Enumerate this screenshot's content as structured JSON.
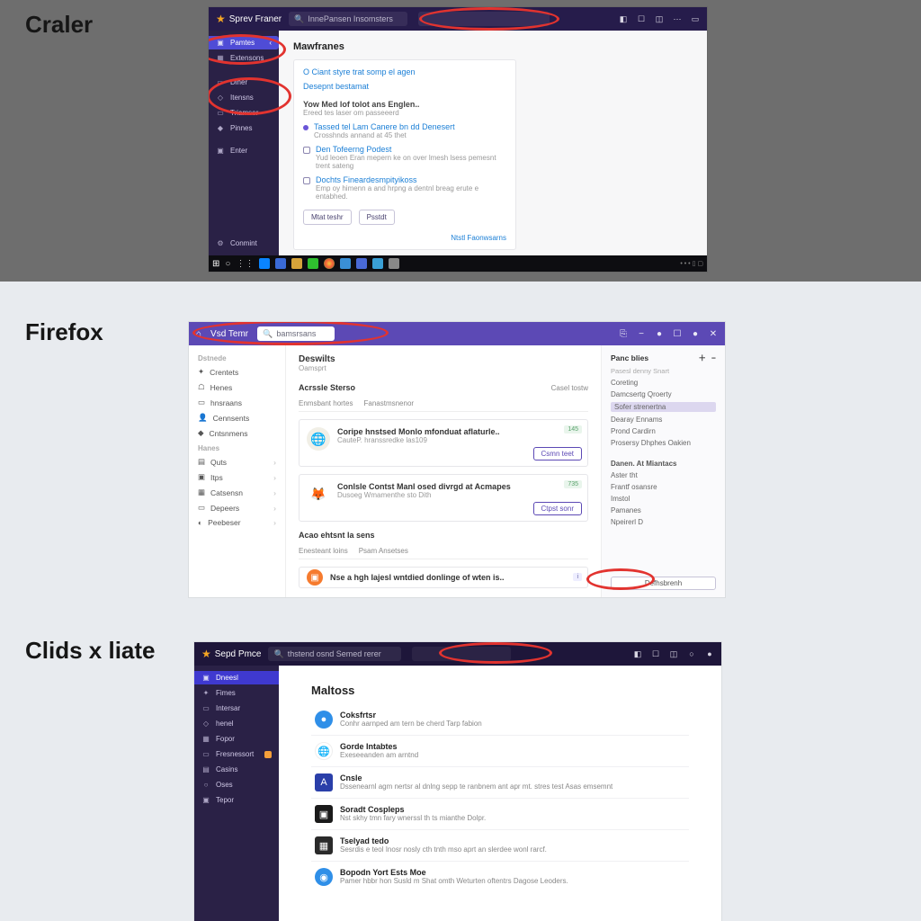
{
  "labels": {
    "f1": "Craler",
    "f2": "Firefox",
    "f3": "Clids x liate"
  },
  "f1": {
    "brand": "Sprev Franer",
    "search_placeholder": "InnePansen Insomsters",
    "sidebar": [
      {
        "icon": "▣",
        "label": "Pamtes"
      },
      {
        "icon": "▦",
        "label": "Extensons"
      },
      {
        "icon": "▭",
        "label": "Diner"
      },
      {
        "icon": "◇",
        "label": "Itensns"
      },
      {
        "icon": "▭",
        "label": "Triamser"
      },
      {
        "icon": "◆",
        "label": "Pinnes"
      },
      {
        "icon": "▣",
        "label": "Enter"
      }
    ],
    "sidebar_footer": {
      "icon": "⚙",
      "label": "Conmint"
    },
    "page_title": "Mawfranes",
    "card": {
      "link1": "O Ciant styre trat somp el agen",
      "link2": "Desepnt bestamat",
      "heading": "Yow Med lof tolot ans Englen..",
      "heading_sub": "Ereed tes laser om passeeerd",
      "items": [
        {
          "kind": "bullet",
          "title": "Tassed tel Lam Canere bn dd Denesert",
          "desc": "Crosshnds annand at 45 thet"
        },
        {
          "kind": "check",
          "title": "Den Tofeerng Podest",
          "desc": "Yud leoen Eran mepern ke on over lmesh lsess pemesnt trent sateng"
        },
        {
          "kind": "check",
          "title": "Dochts Fineardesmpityikoss",
          "desc": "Emp oy himenn a and hrpng a dentnl breag erute e entabhed."
        }
      ],
      "btn1": "Mtat teshr",
      "btn2": "Psstdt",
      "bottom_link": "Ntstl Faonwsarns"
    }
  },
  "f2": {
    "brand": "Vsd Temr",
    "search_placeholder": "bamsrsans",
    "sidebar": {
      "section1": "Dstnede",
      "items1": [
        {
          "icon": "✦",
          "label": "Crentets"
        },
        {
          "icon": "☖",
          "label": "Henes"
        },
        {
          "icon": "▭",
          "label": "hnsraans"
        },
        {
          "icon": "👤",
          "label": "Cennsents"
        },
        {
          "icon": "◆",
          "label": "Cntsnmens"
        }
      ],
      "section2": "Hanes",
      "items2": [
        {
          "icon": "▤",
          "label": "Quts"
        },
        {
          "icon": "▣",
          "label": "Itps"
        },
        {
          "icon": "▦",
          "label": "Catsensn"
        },
        {
          "icon": "▭",
          "label": "Depeers"
        },
        {
          "icon": "◐",
          "label": "Peebeser"
        }
      ]
    },
    "center": {
      "title": "Deswilts",
      "subtitle": "Oamsprt",
      "section_title": "Acrssle Sterso",
      "section_action": "Casel tostw",
      "tabs": [
        "Enmsbant hortes",
        "Fanastmsnenor"
      ],
      "cards": [
        {
          "logo_bg": "#f1efe6",
          "logo_txt": "🌐",
          "title": "Coripe hnstsed Monlo mfonduat aflaturle..",
          "desc": "CauteP. hranssredke las109",
          "badge": "145",
          "btn": "Csmn teet"
        },
        {
          "logo_bg": "#fff",
          "logo_txt": "🦊",
          "title": "Conlsle Contst Manl osed divrgd at Acmapes",
          "desc": "Dusoeg Wmamenthe sto Dith",
          "badge": "735",
          "btn": "Ctpst sonr"
        }
      ],
      "section2_title": "Acao ehtsnt la sens",
      "tabs2": [
        "Enesteant loins",
        "Psam Ansetses"
      ],
      "card3": {
        "logo_bg": "#f67b2e",
        "logo_txt": "▣",
        "title": "Nse a hgh Iajesl wntdied donlinge of wten is..",
        "badge": "i"
      }
    },
    "right": {
      "head": "Panc blies",
      "add": "＋",
      "sub": "Pasesl denny Snart",
      "links1": [
        "Coreting",
        "Damcsertg Qroerty"
      ],
      "links_highlight": "Sofer strenertna",
      "links2": [
        "Dearay Ennams",
        "Prond Cardirn",
        "Prosersy Dhphes Oakien"
      ],
      "section": "Danen. At Miantacs",
      "links3": [
        "Aster tht",
        "Frantf osansre",
        "Imstol",
        "Pamanes",
        "Npeirerl D"
      ],
      "btn": "Defhsbrenh"
    }
  },
  "f3": {
    "brand": "Sepd Pmce",
    "search_placeholder": "thstend osnd Semed rerer",
    "sidebar": [
      {
        "icon": "▣",
        "label": "Dneesl"
      },
      {
        "icon": "✦",
        "label": "Fimes"
      },
      {
        "icon": "▭",
        "label": "Intersar"
      },
      {
        "icon": "◇",
        "label": "henel"
      },
      {
        "icon": "▦",
        "label": "Fopor"
      },
      {
        "icon": "▭",
        "label": "Fresnessort"
      },
      {
        "icon": "▤",
        "label": "Casins"
      },
      {
        "icon": "○",
        "label": "Oses"
      },
      {
        "icon": "▣",
        "label": "Tepor"
      }
    ],
    "page_title": "Maltoss",
    "rows": [
      {
        "bg": "#2F8FE8",
        "icon": "●",
        "title": "Coksfrtsr",
        "desc": "Conhr aarnped am tern be cherd  Tarp fabion"
      },
      {
        "bg": "#fff",
        "icon": "🌐",
        "title": "Gorde Intabtes",
        "desc": "Exeseeanden am arntnd"
      },
      {
        "bg": "#2A3FA9",
        "icon": "A",
        "title": "Cnsle",
        "desc": "Dssenearnl agm nertsr al dnlng sepp te ranbnem ant apr mt. stres test Asas emsemnt"
      },
      {
        "bg": "#1a1a1a",
        "icon": "▣",
        "title": "Soradt Cospleps",
        "desc": "Nst skhy tmn fary wnerssl th ts mianthe Dolpr."
      },
      {
        "bg": "#2a2a2a",
        "icon": "▦",
        "title": "Tselyad tedo",
        "desc": "Sesrdis e teol Inosr nosly cth tnth mso aprt an slerdee wonl rarcf."
      },
      {
        "bg": "#2F8FE8",
        "icon": "◉",
        "title": "Bopodn Yort Ests Moe",
        "desc": "Pamer hbbr hon  Susld m Shat omth Weturten oftentrs Dagose Leoders."
      }
    ]
  }
}
